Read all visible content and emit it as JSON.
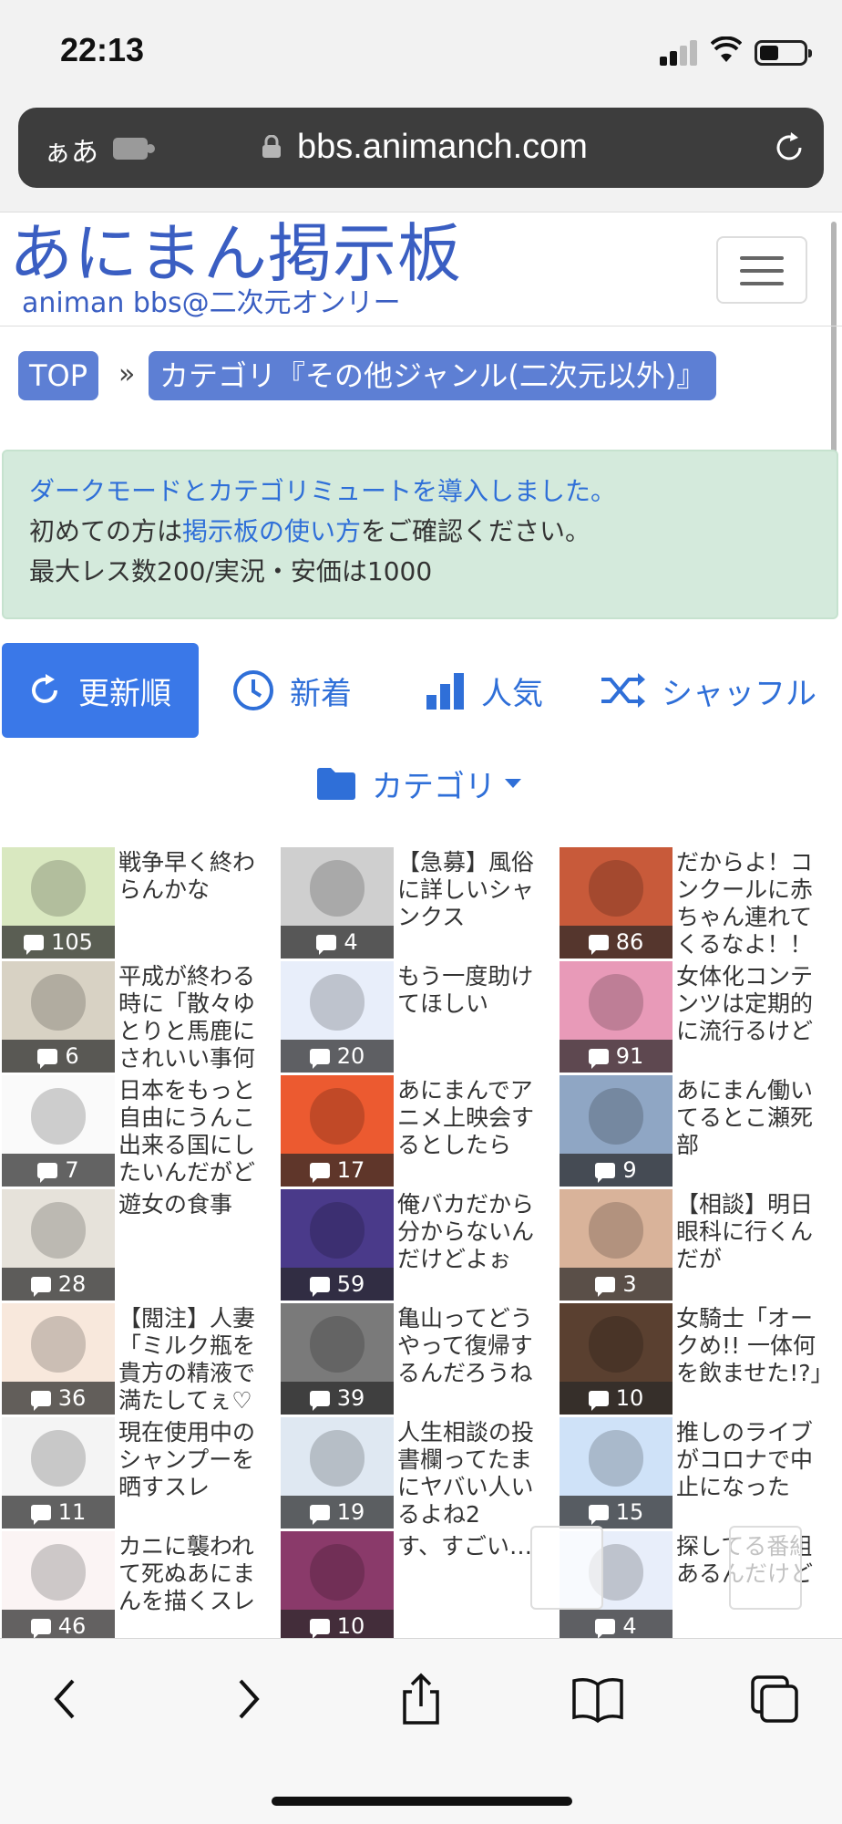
{
  "status_bar": {
    "time": "22:13"
  },
  "browser": {
    "aa_label": "ぁあ",
    "host": "bbs.animanch.com"
  },
  "site": {
    "logo_main": "あにまん掲示板",
    "logo_sub": "animan bbs@二次元オンリー"
  },
  "breadcrumb": {
    "top": "TOP",
    "sep": "»",
    "category": "カテゴリ『その他ジャンル(二次元以外)』"
  },
  "notice": {
    "line1": "ダークモードとカテゴリミュートを導入しました。",
    "line2_prefix": "初めての方は",
    "line2_link": "掲示板の使い方",
    "line2_suffix": "をご確認ください。",
    "line3": "最大レス数200/実況・安価は1000"
  },
  "tabs": [
    {
      "label": "更新順",
      "icon": "refresh-icon",
      "active": true
    },
    {
      "label": "新着",
      "icon": "clock-icon",
      "active": false
    },
    {
      "label": "人気",
      "icon": "bar-chart-icon",
      "active": false
    },
    {
      "label": "シャッフル",
      "icon": "shuffle-icon",
      "active": false
    }
  ],
  "category_menu": {
    "label": "カテゴリ",
    "icon": "folder-icon"
  },
  "threads": [
    {
      "title": "戦争早く終わらんかな",
      "count": "105",
      "thumb": "soldier",
      "thumb_color": "#d9e8c0"
    },
    {
      "title": "【急募】風俗に詳しいシャンクス",
      "count": "4",
      "thumb": "manga",
      "thumb_color": "#cfcfcf"
    },
    {
      "title": "だからよ！コンクールに赤ちゃん連れてくるなよ！！",
      "count": "86",
      "thumb": "anime-face",
      "thumb_color": "#c85a3a"
    },
    {
      "title": "平成が終わる時に「散々ゆとりと馬鹿にされいい事何",
      "count": "6",
      "thumb": "heisei",
      "thumb_color": "#d8d2c4"
    },
    {
      "title": "もう一度助けてほしい",
      "count": "20",
      "thumb": "logo",
      "thumb_color": "#e8eefa"
    },
    {
      "title": "女体化コンテンツは定期的に流行るけど",
      "count": "91",
      "thumb": "sword",
      "thumb_color": "#e89ab8"
    },
    {
      "title": "日本をもっと自由にうんこ出来る国にしたいんだがど",
      "count": "7",
      "thumb": "poop",
      "thumb_color": "#fafafa"
    },
    {
      "title": "あにまんでアニメ上映会するとしたら",
      "count": "17",
      "thumb": "d-logo",
      "thumb_color": "#ec5a30"
    },
    {
      "title": "あにまん働いてるとこ瀬死部",
      "count": "9",
      "thumb": "ferris",
      "thumb_color": "#8fa6c4"
    },
    {
      "title": "遊女の食事",
      "count": "28",
      "thumb": "document",
      "thumb_color": "#e6e2da"
    },
    {
      "title": "俺バカだから分からないんだけどよぉ",
      "count": "59",
      "thumb": "villain",
      "thumb_color": "#4a3a8a"
    },
    {
      "title": "【相談】明日眼科に行くんだが",
      "count": "3",
      "thumb": "eyes",
      "thumb_color": "#d9b39a"
    },
    {
      "title": "【閲注】人妻「ミルク瓶を貴方の精液で満たしてぇ♡",
      "count": "36",
      "thumb": "baby",
      "thumb_color": "#f8e8dc"
    },
    {
      "title": "亀山ってどうやって復帰するんだろうね",
      "count": "39",
      "thumb": "man",
      "thumb_color": "#7a7a7a"
    },
    {
      "title": "女騎士「オークめ!! 一体何を飲ませた!?」",
      "count": "10",
      "thumb": "orc",
      "thumb_color": "#5a4030"
    },
    {
      "title": "現在使用中のシャンプーを晒すスレ",
      "count": "11",
      "thumb": "bottles",
      "thumb_color": "#f4f4f4"
    },
    {
      "title": "人生相談の投書欄ってたまにヤバい人いるよね2",
      "count": "19",
      "thumb": "penguin",
      "thumb_color": "#dfe8f2"
    },
    {
      "title": "推しのライブがコロナで中止になった",
      "count": "15",
      "thumb": "sick",
      "thumb_color": "#cfe2f8"
    },
    {
      "title": "カニに襲われて死ぬあにまんを描くスレ",
      "count": "46",
      "thumb": "crab",
      "thumb_color": "#fbf4f4"
    },
    {
      "title": "す、すごい…",
      "count": "10",
      "thumb": "anime-poster",
      "thumb_color": "#8a3a6a"
    },
    {
      "title": "探してる番組あるんだけど",
      "count": "4",
      "thumb": "logo",
      "thumb_color": "#e8eefa"
    }
  ],
  "colors": {
    "accent": "#3a78e8",
    "breadcrumb": "#5d7fd4",
    "notice_bg": "#d4eadc",
    "logo": "#3a5ec2"
  },
  "toolbar": [
    {
      "icon": "back-icon"
    },
    {
      "icon": "forward-icon"
    },
    {
      "icon": "share-icon"
    },
    {
      "icon": "bookmarks-icon"
    },
    {
      "icon": "tabs-icon"
    }
  ]
}
